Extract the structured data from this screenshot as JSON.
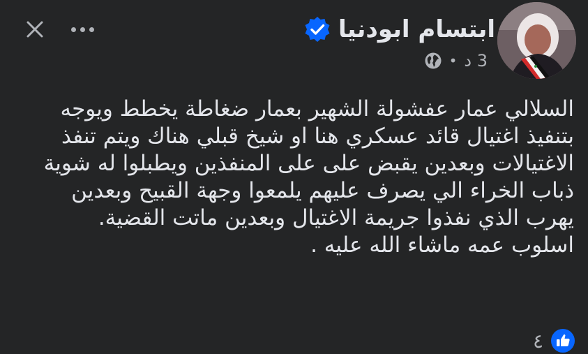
{
  "header": {
    "author_name": "ابتسام ابودنيا",
    "timestamp": "3 د",
    "separator": "•",
    "verified_icon": "verified-badge-icon",
    "privacy_icon": "globe-icon"
  },
  "controls": {
    "close_icon": "close-icon",
    "more_icon": "more-options-icon"
  },
  "post": {
    "paragraph_1": "السلالي عمار عفشولة الشهير بعمار ضغاطة يخطط ويوجه بتنفيذ اغتيال قائد عسكري هنا او شيخ قبلي هناك ويتم تنفذ الاغتيالات وبعدين يقبض على على المنفذين ويطبلوا له شوية ذباب الخراء الي يصرف عليهم يلمعوا وجهة القبيح وبعدين يهرب الذي نفذوا جريمة الاغتيال وبعدين ماتت القضية.",
    "paragraph_2": "اسلوب عمه ماشاء الله عليه ."
  },
  "reactions": {
    "count": "٤",
    "icon": "like-icon"
  },
  "colors": {
    "background": "#242526",
    "primary_text": "#e4e6eb",
    "secondary_text": "#b0b3b8",
    "accent_blue": "#0866ff"
  }
}
